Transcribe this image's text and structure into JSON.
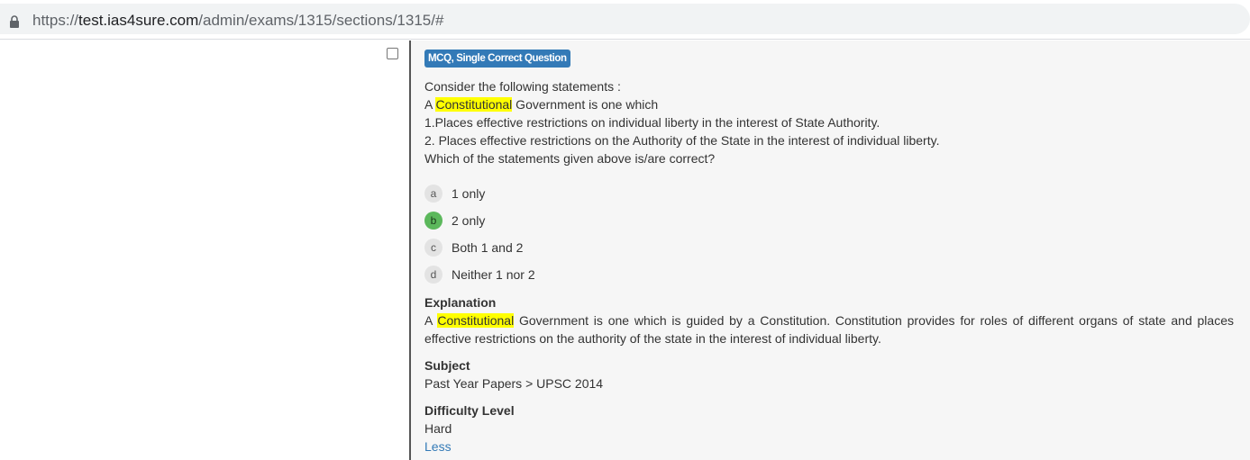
{
  "browser": {
    "url_prefix": "https://",
    "url_host": "test.ias4sure.com",
    "url_path": "/admin/exams/1315/sections/1315/#",
    "lock_icon": "lock-icon"
  },
  "question": {
    "type_badge": "MCQ, Single Correct Question",
    "intro": "Consider the following statements :",
    "line2_pre": "A ",
    "highlight_word": "Constitutional",
    "line2_post": " Government is one which",
    "statement1": "1.Places effective restrictions on individual liberty in the interest of State Authority.",
    "statement2": "2. Places effective restrictions on the Authority of the State in the interest of individual liberty.",
    "prompt": "Which of the statements given above is/are correct?"
  },
  "options": [
    {
      "letter": "a",
      "text": "1 only",
      "correct": false
    },
    {
      "letter": "b",
      "text": "2 only",
      "correct": true
    },
    {
      "letter": "c",
      "text": "Both 1 and 2",
      "correct": false
    },
    {
      "letter": "d",
      "text": "Neither 1 nor 2",
      "correct": false
    }
  ],
  "explanation": {
    "title": "Explanation",
    "pre": "A ",
    "highlight_word": "Constitutional",
    "post": " Government is one which is guided by a Constitution. Constitution provides for roles of different organs of state and places effective restrictions on the authority of the state in the interest of individual liberty."
  },
  "subject": {
    "title": "Subject",
    "value": "Past Year Papers > UPSC 2014"
  },
  "difficulty": {
    "title": "Difficulty Level",
    "value": "Hard"
  },
  "less_link": "Less",
  "colors": {
    "badge": "#337ab7",
    "correct": "#5cb85c",
    "highlight": "#ffff00",
    "link": "#337ab7"
  }
}
